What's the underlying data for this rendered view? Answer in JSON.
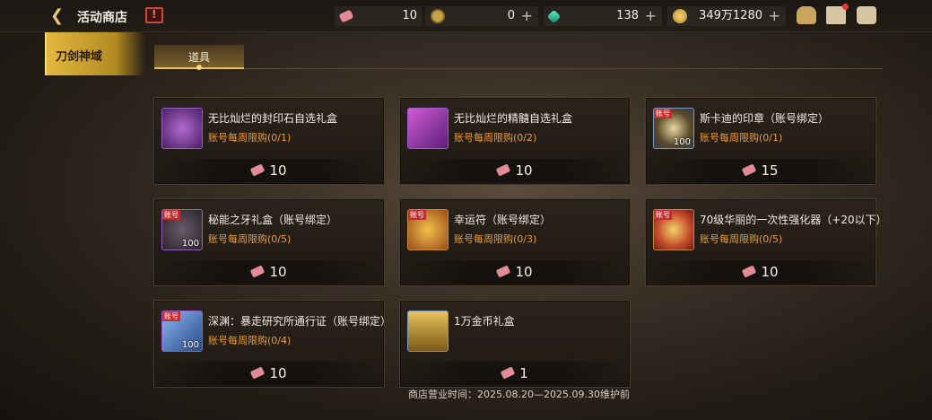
{
  "header": {
    "back_icon": "back-arrow-icon",
    "title": "活动商店",
    "calendar_icon": "calendar-alert-icon",
    "currencies": [
      {
        "icon": "ticket-icon",
        "value": "10"
      },
      {
        "icon": "coin-icon",
        "value": "0"
      },
      {
        "icon": "gem-icon",
        "value": "138"
      },
      {
        "icon": "gold-icon",
        "value": "349万1280"
      }
    ],
    "plus_symbol": "+",
    "right_icons": [
      "bag-icon",
      "mail-icon",
      "chat-icon"
    ]
  },
  "sidebar": {
    "active_tab": "刀剑神域"
  },
  "subtabs": [
    {
      "label": "道具",
      "active": true
    }
  ],
  "items": [
    {
      "name": "无比灿烂的封印石自选礼盒",
      "limit": "账号每周限购(0/1)",
      "price": "10",
      "badge": "",
      "qty": "",
      "icon": "seal-stone-icon"
    },
    {
      "name": "无比灿烂的精髓自选礼盒",
      "limit": "账号每周限购(0/2)",
      "price": "10",
      "badge": "",
      "qty": "",
      "icon": "essence-box-icon"
    },
    {
      "name": "斯卡迪的印章（账号绑定）",
      "limit": "账号每周限购(0/1)",
      "price": "15",
      "badge": "账号",
      "qty": "100",
      "icon": "stamp-icon"
    },
    {
      "name": "秘能之牙礼盒（账号绑定）",
      "limit": "账号每周限购(0/5)",
      "price": "10",
      "badge": "账号",
      "qty": "100",
      "icon": "fang-icon"
    },
    {
      "name": "幸运符（账号绑定）",
      "limit": "账号每周限购(0/3)",
      "price": "10",
      "badge": "账号",
      "qty": "",
      "icon": "lucky-charm-icon"
    },
    {
      "name": "70级华丽的一次性强化器（+20以下）",
      "limit": "账号每周限购(0/5)",
      "price": "10",
      "badge": "账号",
      "qty": "",
      "icon": "enhancer-icon"
    },
    {
      "name": "深渊：暴走研究所通行证（账号绑定）",
      "limit": "账号每周限购(0/4)",
      "price": "10",
      "badge": "账号",
      "qty": "100",
      "icon": "pass-ticket-icon"
    },
    {
      "name": "1万金币礼盒",
      "limit": "",
      "price": "1",
      "badge": "",
      "qty": "",
      "icon": "gold-chest-icon"
    }
  ],
  "footer": {
    "hours": "商店营业时间：2025.08.20—2025.09.30维护前"
  }
}
